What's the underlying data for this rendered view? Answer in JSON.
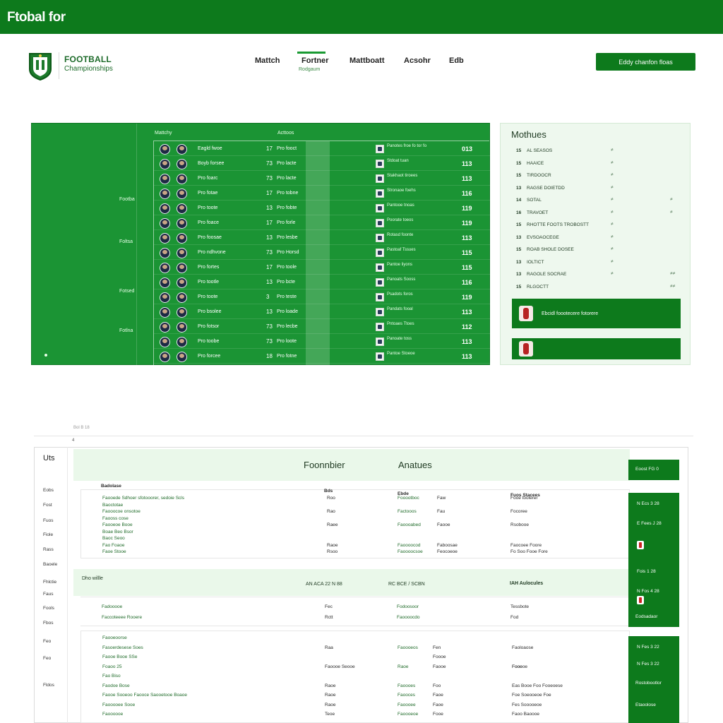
{
  "topbar": {
    "title": "Ftobal for"
  },
  "logo": {
    "line1": "FOOTBALL",
    "line2": "Championships"
  },
  "nav": {
    "items": [
      "Mattch",
      "Fortner",
      "Mattboatt",
      "Acsohr",
      "Edb"
    ],
    "sub": "Rodgaum"
  },
  "cta": {
    "label": "Eddy chanfon floas"
  },
  "colors": {
    "brand": "#0d7a1c",
    "panel": "#1b9434",
    "soft": "#eaf8ea"
  },
  "left_panel": {
    "col_head_1": "Mattchy",
    "col_head_2": "Acttoos",
    "rail_labels": [
      "Footba",
      "Foltsa",
      "Fotsed",
      "Fotlna"
    ],
    "rows": [
      {
        "team": "Eagld fwoe",
        "num": "17",
        "code": "Pro fooct",
        "info": "Panotes froe fo tor fo ",
        "score": "013"
      },
      {
        "team": "Boyb forsee",
        "num": "73",
        "code": "Pro lacte",
        "info": "Stdoat tuan ",
        "score": "113"
      },
      {
        "team": "Pro foarc",
        "num": "73",
        "code": "Pro lacte",
        "info": "Stakhaot tiroees ",
        "score": "113"
      },
      {
        "team": "Pro fotae",
        "num": "17",
        "code": "Pro tobne",
        "info": "Stronaoe foehs ",
        "score": "116"
      },
      {
        "team": "Pro toote",
        "num": "13",
        "code": "Pro fobte",
        "info": "Pantooe tnoas ",
        "score": "119"
      },
      {
        "team": "Pro foace",
        "num": "17",
        "code": "Pro forle",
        "info": "Poorate toeos ",
        "score": "119"
      },
      {
        "team": "Pro foosae",
        "num": "13",
        "code": "Pro lesbe",
        "info": "Rotasd foonte ",
        "score": "113"
      },
      {
        "team": "Pro ndhvone",
        "num": "73",
        "code": "Pro Horsd",
        "info": "Pastoaf Tssues ",
        "score": "115"
      },
      {
        "team": "Pro fortes",
        "num": "17",
        "code": "Pro toole",
        "info": "Pantoe liyons ",
        "score": "115"
      },
      {
        "team": "Pro tootle",
        "num": "13",
        "code": "Pro bcte",
        "info": "Panoats Sooss ",
        "score": "116"
      },
      {
        "team": "Pro toote",
        "num": "3",
        "code": "Pro teste",
        "info": "Psadots foros ",
        "score": "119"
      },
      {
        "team": "Pro bsolee",
        "num": "13",
        "code": "Pro loade",
        "info": "Pandats fooal ",
        "score": "113"
      },
      {
        "team": "Pro fotsor",
        "num": "73",
        "code": "Pro lecbe",
        "info": "Pntoaes Ttoes ",
        "score": "112"
      },
      {
        "team": "Pro toobe",
        "num": "73",
        "code": "Pro loote",
        "info": "Panoate toss ",
        "score": "113"
      },
      {
        "team": "Pro forcee",
        "num": "18",
        "code": "Pro fotne",
        "info": "Pantoe Stoeoe ",
        "score": "113"
      }
    ]
  },
  "right_panel": {
    "title": "Mothues",
    "rows": [
      {
        "n": "15",
        "label": "AL SEASOS",
        "a": "≠",
        "b": ""
      },
      {
        "n": "15",
        "label": "HAAICE",
        "a": "≠",
        "b": ""
      },
      {
        "n": "15",
        "label": "TIRDOOCR",
        "a": "≠",
        "b": ""
      },
      {
        "n": "13",
        "label": "RAGSE DOIETDD",
        "a": "≠",
        "b": ""
      },
      {
        "n": "14",
        "label": "SOTAL",
        "a": "≠",
        "b": "≠"
      },
      {
        "n": "16",
        "label": "TRAVOET",
        "a": "≠",
        "b": "≠"
      },
      {
        "n": "15",
        "label": "RHOTTE FOOTS TROBOSTT",
        "a": "≠",
        "b": ""
      },
      {
        "n": "13",
        "label": "EVSOAOCEGE",
        "a": "≠",
        "b": ""
      },
      {
        "n": "15",
        "label": "ROAB SHOLE DOSEE",
        "a": "≠",
        "b": ""
      },
      {
        "n": "13",
        "label": "IOLTICT",
        "a": "≠",
        "b": ""
      },
      {
        "n": "13",
        "label": "RAGOLE SOCRAE",
        "a": "≠",
        "b": "≠≠"
      },
      {
        "n": "15",
        "label": "RLGOCTT",
        "a": "",
        "b": "≠≠"
      }
    ],
    "promo1": "Ebcidl foootecere fotorere",
    "promo2": ""
  },
  "lower": {
    "meta1": "Bol B 18",
    "meta2": "4",
    "side_title": "Uts",
    "side_links": [
      "Eobs",
      "Fost",
      "Fuos",
      "Fiole",
      "Rass",
      "Baoele",
      "Fhlctie",
      "Faus",
      "Fools",
      "Fbos",
      "Feo",
      "Feo",
      "Fldos"
    ],
    "band1_title_a": "Foonnbier",
    "band1_title_b": "Anatues",
    "band2_text_a": "Dho willle",
    "band2_text_b": "AN ACA 22 N 88",
    "band2_text_c": "RC BCE / SCBN",
    "band2_text_d": "IAH Aulocules",
    "right_boxes": [
      {
        "text": "Eoost  FG 0"
      },
      {
        "text": "N  Ecs   3 28"
      },
      {
        "text": "E  Fees  J 28"
      },
      {
        "text": "Fois  1 28"
      },
      {
        "text": "N   Fos  4 28"
      },
      {
        "text": "N   Fos  4 28"
      },
      {
        "text": "Eodsadaor"
      },
      {
        "text": "N   Fes   3 22"
      },
      {
        "text": "N   Fes   3 22"
      },
      {
        "text": "Rostobootlor"
      },
      {
        "text": "Etaoolose"
      }
    ],
    "table1": {
      "head": [
        "Badolase",
        "Bds",
        "Ebde",
        "Fuos Stacees"
      ],
      "rows": [
        [
          "Faooede Sdhoer sfotooorer, sedoie Scls",
          "Roo",
          "Fooootboc",
          "Faw",
          "Fooe toolerer"
        ],
        [
          "Baoctotae",
          "",
          "",
          "",
          ""
        ],
        [
          "Faooocoe onsotoe",
          "Rao",
          "Factooos",
          "Fau",
          "Focoree"
        ],
        [
          "Faooss cose",
          "",
          "",
          "",
          ""
        ],
        [
          "Faooeoe Booe",
          "Raee",
          "Faoooabed",
          "Faooe",
          "Rsobooe"
        ],
        [
          "Boae Beo Bsor",
          "",
          "",
          "",
          ""
        ],
        [
          "Baoc Seoo",
          "",
          "",
          "",
          ""
        ],
        [
          "Fao Foaoe",
          "Raoe",
          "Faoooocod",
          "Faboosae",
          "Faocoee Foore"
        ],
        [
          "Faoe Stooe",
          "Rsoo",
          "Faoooocsoe",
          "Feocoeoe",
          "Fo Soo Fooe Fore"
        ]
      ]
    },
    "table2": {
      "rows": [
        [
          "Fadooooe",
          "Fec",
          "Fodoosoor",
          "Tessbote"
        ],
        [
          "Faccoteeee Rooere",
          "Rctt",
          "Faoooocdo",
          "Fod",
          ""
        ]
      ]
    },
    "table3": {
      "rows": [
        [
          "Faooeoorse",
          "",
          "",
          "",
          ""
        ],
        [
          "Fasoerdesese Soes",
          "Raa",
          "Faoooeos",
          "Fen",
          "Faoloaose"
        ],
        [
          "Faooe Booe SSe",
          "",
          "",
          "Foooe",
          ""
        ],
        [
          "Foaoo 25",
          "Faoooe Seooe",
          "Raoe",
          "Faooe",
          "Fooe",
          "Fooeoe"
        ],
        [
          "Fao    Biso",
          "",
          "",
          "",
          ""
        ],
        [
          "Faodoe Bose",
          "Raoe",
          "Faoooes",
          "Foo",
          "Eas Booe Foo Fooeoese"
        ],
        [
          "Faooe Sooeoo Faooce Saooetooe Boaoe",
          "Raoe",
          "Faooces",
          "Faoe",
          "Foe Soeooeoe Foe"
        ],
        [
          "Faooooee Sooe",
          "Raoe",
          "Faoooee",
          "Faoe",
          "Fes Sooooeoe"
        ],
        [
          "Faoooooe",
          "Teoe",
          "Faoooeoe",
          "Fooe",
          "Faoo Baoooe"
        ]
      ]
    }
  }
}
